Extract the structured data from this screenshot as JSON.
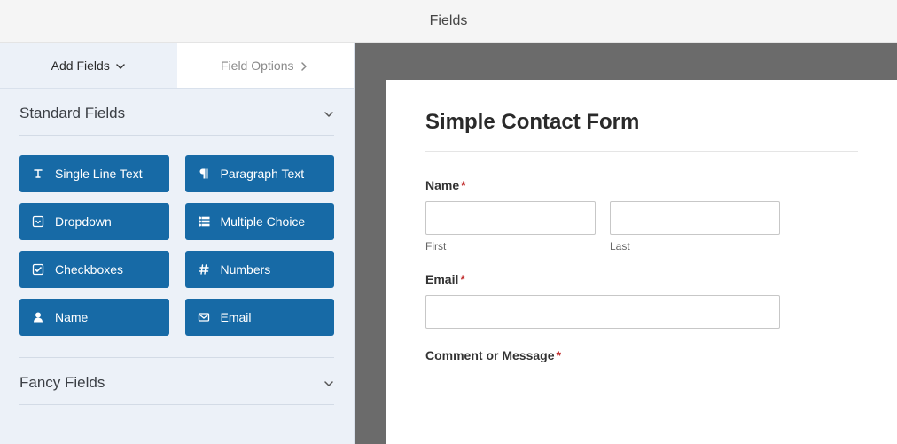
{
  "header": {
    "title": "Fields"
  },
  "tabs": {
    "add": "Add Fields",
    "options": "Field Options"
  },
  "sections": {
    "standard": {
      "title": "Standard Fields",
      "items": [
        {
          "label": "Single Line Text",
          "icon": "text-cursor"
        },
        {
          "label": "Paragraph Text",
          "icon": "paragraph"
        },
        {
          "label": "Dropdown",
          "icon": "dropdown-square"
        },
        {
          "label": "Multiple Choice",
          "icon": "list"
        },
        {
          "label": "Checkboxes",
          "icon": "check-square"
        },
        {
          "label": "Numbers",
          "icon": "hash"
        },
        {
          "label": "Name",
          "icon": "user"
        },
        {
          "label": "Email",
          "icon": "envelope"
        }
      ]
    },
    "fancy": {
      "title": "Fancy Fields"
    }
  },
  "form": {
    "title": "Simple Contact Form",
    "labels": {
      "name": "Name",
      "first": "First",
      "last": "Last",
      "email": "Email",
      "comment": "Comment or Message",
      "required_mark": "*"
    }
  }
}
